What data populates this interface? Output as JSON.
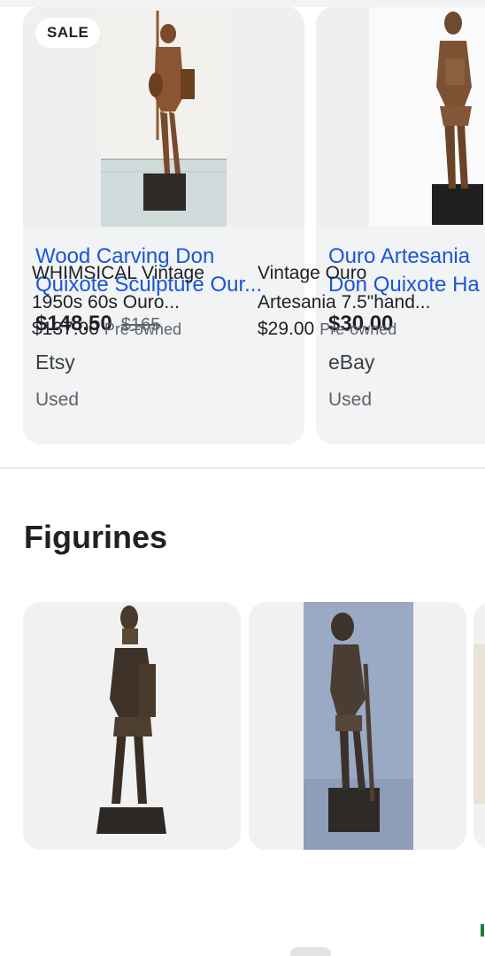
{
  "products": [
    {
      "badge": "SALE",
      "title_line1": "Wood Carving Don",
      "title_line2": "Quixote Sculpture Our...",
      "price": "$148.50",
      "old_price": "$165",
      "seller": "Etsy",
      "condition": "Used"
    },
    {
      "title_line1": "Ouro Artesania",
      "title_line2": "Don Quixote Ha",
      "price": "$30.00",
      "seller": "eBay",
      "condition": "Used"
    }
  ],
  "figurines": {
    "section_title": "Figurines",
    "items": [
      {
        "title_line1": "WHIMSICAL Vintage",
        "title_line2": "1950s 60s Ouro...",
        "price": "$137.00",
        "condition": "Pre-owned"
      },
      {
        "title_line1": "Vintage Ouro",
        "title_line2": "Artesania 7.5\"hand...",
        "price": "$29.00",
        "condition": "Pre-owned"
      }
    ]
  },
  "colors": {
    "title_link": "#1a56d6",
    "card_bg": "#f1f3f4",
    "green_peek": "#188038"
  },
  "icons": [
    "don-quixote-statue-image",
    "scroll-handle"
  ]
}
